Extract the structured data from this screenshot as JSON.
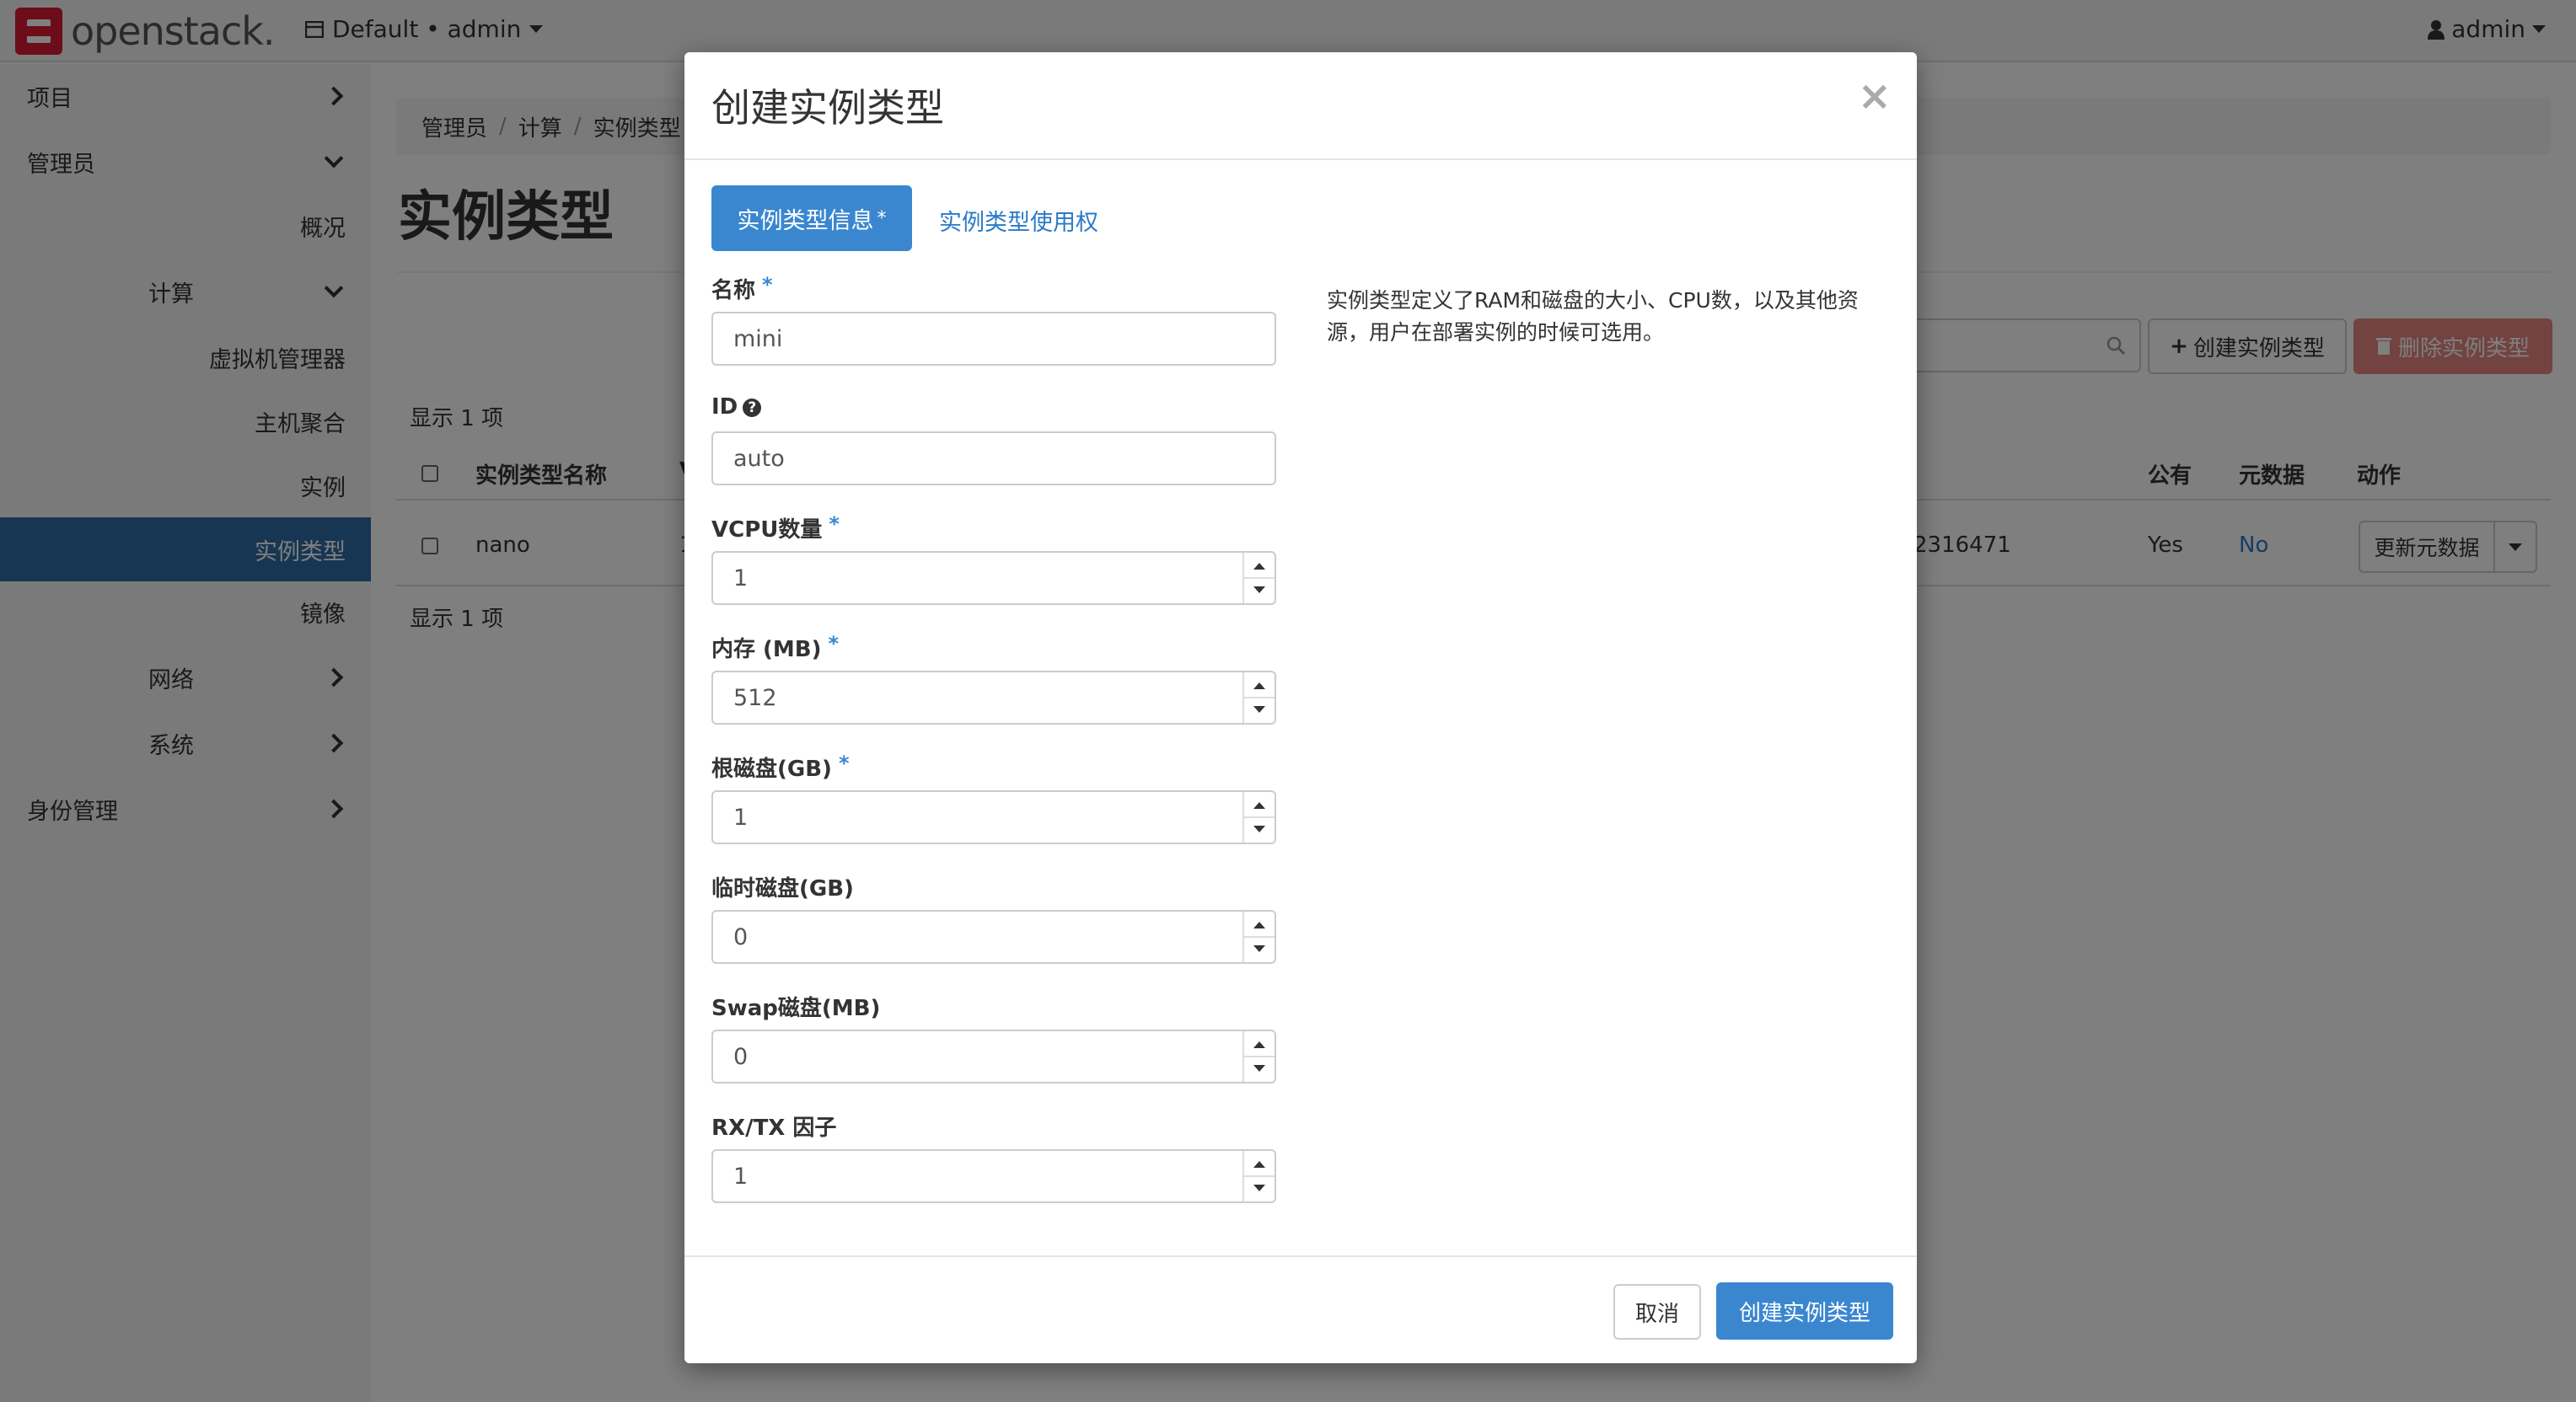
{
  "navbar": {
    "logo_text": "openstack.",
    "project": "Default • admin",
    "user": "admin"
  },
  "sidebar": {
    "items": [
      {
        "label": "项目"
      },
      {
        "label": "管理员"
      },
      {
        "label": "概况"
      },
      {
        "label": "计算"
      },
      {
        "label": "虚拟机管理器"
      },
      {
        "label": "主机聚合"
      },
      {
        "label": "实例"
      },
      {
        "label": "实例类型"
      },
      {
        "label": "镜像"
      },
      {
        "label": "网络"
      },
      {
        "label": "系统"
      },
      {
        "label": "身份管理"
      }
    ]
  },
  "main": {
    "breadcrumb": [
      "管理员",
      "计算",
      "实例类型"
    ],
    "title": "实例类型",
    "create_button": "创建实例类型",
    "delete_button": "删除实例类型",
    "count_text": "显示 1 项",
    "columns": [
      "实例类型名称",
      "V",
      "公有",
      "元数据",
      "动作"
    ],
    "row": {
      "name": "nano",
      "col_b": "1",
      "id_fragment": "2316471",
      "public": "Yes",
      "metadata": "No",
      "action": "更新元数据"
    }
  },
  "modal": {
    "title": "创建实例类型",
    "close": "×",
    "tab_info": "实例类型信息",
    "tab_info_marker": "*",
    "tab_access": "实例类型使用权",
    "description": "实例类型定义了RAM和磁盘的大小、CPU数，以及其他资源，用户在部署实例的时候可选用。",
    "fields": {
      "name": {
        "label": "名称",
        "required": "*",
        "value": "mini"
      },
      "id": {
        "label": "ID",
        "help": "?",
        "value": "auto"
      },
      "vcpus": {
        "label": "VCPU数量",
        "required": "*",
        "value": "1"
      },
      "ram": {
        "label": "内存 (MB)",
        "required": "*",
        "value": "512"
      },
      "disk": {
        "label": "根磁盘(GB)",
        "required": "*",
        "value": "1"
      },
      "ephemeral": {
        "label": "临时磁盘(GB)",
        "value": "0"
      },
      "swap": {
        "label": "Swap磁盘(MB)",
        "value": "0"
      },
      "rxtx": {
        "label": "RX/TX 因子",
        "value": "1"
      }
    },
    "cancel": "取消",
    "submit": "创建实例类型"
  }
}
